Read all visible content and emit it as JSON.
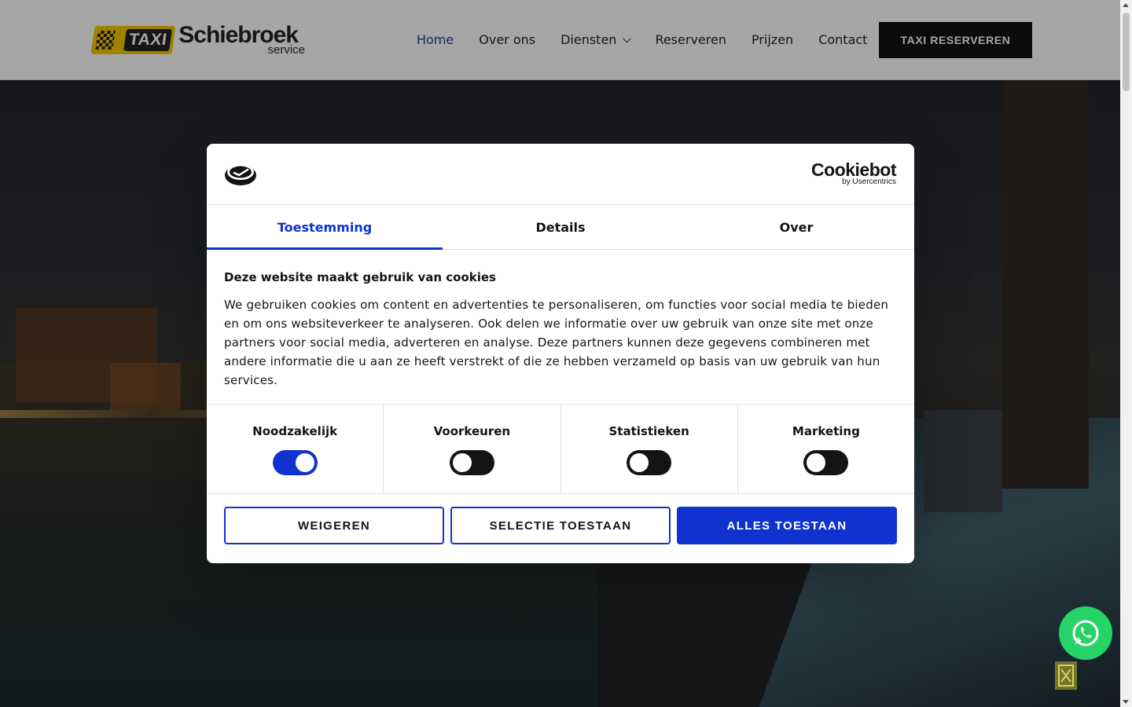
{
  "header": {
    "logo": {
      "badge": "TAXI",
      "brand": "Schiebroek",
      "sub": "service"
    },
    "nav": [
      {
        "label": "Home",
        "active": true
      },
      {
        "label": "Over ons"
      },
      {
        "label": "Diensten",
        "has_dropdown": true
      },
      {
        "label": "Reserveren"
      },
      {
        "label": "Prijzen"
      },
      {
        "label": "Contact"
      }
    ],
    "cta_label": "TAXI RESERVEREN"
  },
  "cookie_dialog": {
    "provider_logo": {
      "line1": "Cookiebot",
      "line2": "by Usercentrics"
    },
    "tabs": [
      {
        "label": "Toestemming",
        "active": true
      },
      {
        "label": "Details"
      },
      {
        "label": "Over"
      }
    ],
    "heading": "Deze website maakt gebruik van cookies",
    "body": "We gebruiken cookies om content en advertenties te personaliseren, om functies voor social media te bieden en om ons websiteverkeer te analyseren. Ook delen we informatie over uw gebruik van onze site met onze partners voor social media, adverteren en analyse. Deze partners kunnen deze gegevens combineren met andere informatie die u aan ze heeft verstrekt of die ze hebben verzameld op basis van uw gebruik van hun services.",
    "categories": [
      {
        "label": "Noodzakelijk",
        "enabled": true
      },
      {
        "label": "Voorkeuren",
        "enabled": false
      },
      {
        "label": "Statistieken",
        "enabled": false
      },
      {
        "label": "Marketing",
        "enabled": false
      }
    ],
    "buttons": {
      "decline": "WEIGEREN",
      "allow_selection": "SELECTIE TOESTAAN",
      "allow_all": "ALLES TOESTAAN"
    }
  },
  "colors": {
    "accent": "#1032cf",
    "nav_active": "#1f3f86",
    "cta_bg": "#111111",
    "whatsapp": "#25d366",
    "logo_yellow": "#f6c800"
  },
  "icons": [
    "whatsapp-icon",
    "cookiebot-icon",
    "chevron-down-icon"
  ]
}
